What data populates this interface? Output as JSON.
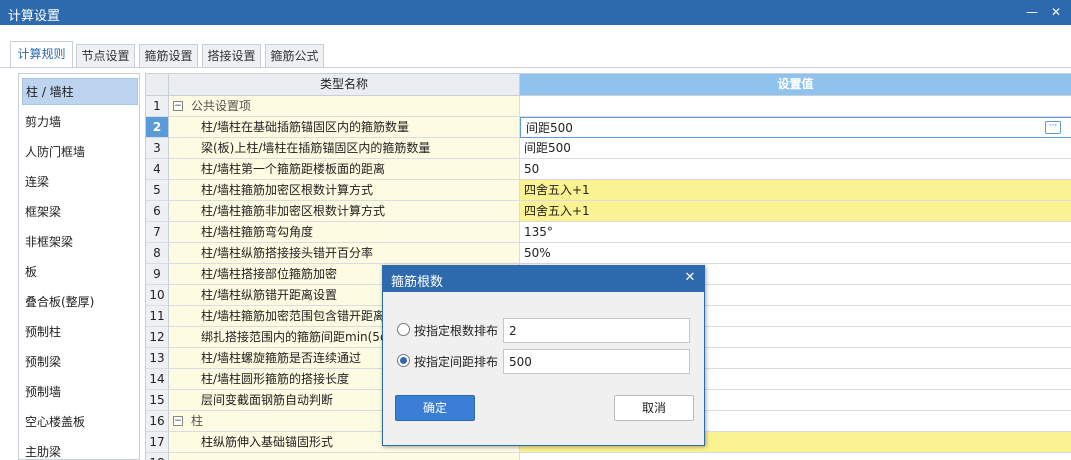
{
  "window": {
    "title": "计算设置",
    "minimize_symbol": "—",
    "close_symbol": "✕"
  },
  "tabs": [
    {
      "label": "计算规则",
      "active": true
    },
    {
      "label": "节点设置",
      "active": false
    },
    {
      "label": "箍筋设置",
      "active": false
    },
    {
      "label": "搭接设置",
      "active": false
    },
    {
      "label": "箍筋公式",
      "active": false
    }
  ],
  "categories": [
    {
      "label": "柱 / 墙柱",
      "selected": true
    },
    {
      "label": "剪力墙"
    },
    {
      "label": "人防门框墙"
    },
    {
      "label": "连梁"
    },
    {
      "label": "框架梁"
    },
    {
      "label": "非框架梁"
    },
    {
      "label": "板"
    },
    {
      "label": "叠合板(整厚)"
    },
    {
      "label": "预制柱"
    },
    {
      "label": "预制梁"
    },
    {
      "label": "预制墙"
    },
    {
      "label": "空心楼盖板"
    },
    {
      "label": "主肋梁"
    }
  ],
  "grid": {
    "headers": {
      "name": "类型名称",
      "value": "设置值"
    },
    "ellipsis_symbol": "···",
    "rows": [
      {
        "num": "1",
        "toggle": "−",
        "group": "公共设置项",
        "name": "",
        "value": ""
      },
      {
        "num": "2",
        "name": "柱/墙柱在基础插筋锚固区内的箍筋数量",
        "value": "间距500",
        "current": true
      },
      {
        "num": "3",
        "name": "梁(板)上柱/墙柱在插筋锚固区内的箍筋数量",
        "value": "间距500"
      },
      {
        "num": "4",
        "name": "柱/墙柱第一个箍筋距楼板面的距离",
        "value": "50"
      },
      {
        "num": "5",
        "name": "柱/墙柱箍筋加密区根数计算方式",
        "value": "四舍五入+1",
        "highlight": true
      },
      {
        "num": "6",
        "name": "柱/墙柱箍筋非加密区根数计算方式",
        "value": "四舍五入+1",
        "highlight": true
      },
      {
        "num": "7",
        "name": "柱/墙柱箍筋弯勾角度",
        "value": "135°"
      },
      {
        "num": "8",
        "name": "柱/墙柱纵筋搭接接头错开百分率",
        "value": "50%"
      },
      {
        "num": "9",
        "name": "柱/墙柱搭接部位箍筋加密",
        "value": ""
      },
      {
        "num": "10",
        "name": "柱/墙柱纵筋错开距离设置",
        "value": ""
      },
      {
        "num": "11",
        "name": "柱/墙柱箍筋加密范围包含错开距离",
        "value": ""
      },
      {
        "num": "12",
        "name": "绑扎搭接范围内的箍筋间距min(5d",
        "value": ""
      },
      {
        "num": "13",
        "name": "柱/墙柱螺旋箍筋是否连续通过",
        "value": ""
      },
      {
        "num": "14",
        "name": "柱/墙柱圆形箍筋的搭接长度",
        "value": ""
      },
      {
        "num": "15",
        "name": "层间变截面钢筋自动判断",
        "value": ""
      },
      {
        "num": "16",
        "toggle": "−",
        "group": "柱",
        "name": "",
        "value": ""
      },
      {
        "num": "17",
        "name": "柱纵筋伸入基础锚固形式",
        "value": "",
        "highlight": true
      },
      {
        "num": "18",
        "name": "",
        "value": ""
      }
    ]
  },
  "dialog": {
    "title": "箍筋根数",
    "close_symbol": "✕",
    "options": [
      {
        "label": "按指定根数排布",
        "value": "2",
        "checked": false
      },
      {
        "label": "按指定间距排布",
        "value": "500",
        "checked": true
      }
    ],
    "ok_label": "确定",
    "cancel_label": "取消"
  }
}
